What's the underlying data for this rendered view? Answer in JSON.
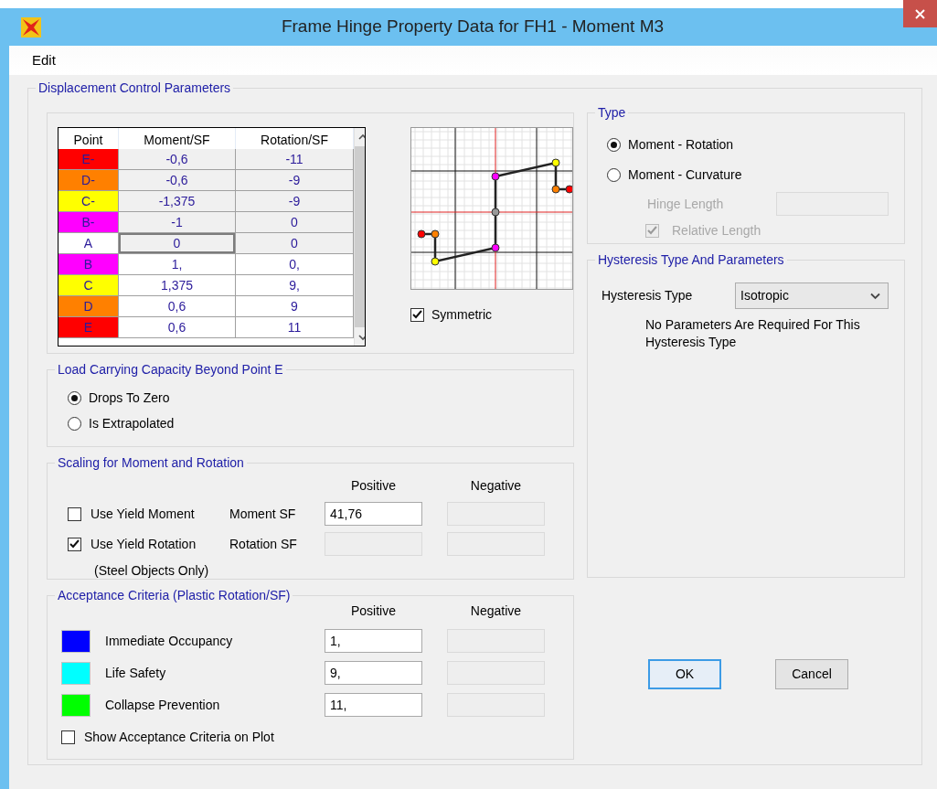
{
  "window": {
    "title": "Frame Hinge Property Data for FH1 - Moment M3"
  },
  "menu": [
    {
      "label": "Edit"
    }
  ],
  "displacement": {
    "title": "Displacement Control Parameters",
    "table": {
      "columns": [
        "Point",
        "Moment/SF",
        "Rotation/SF"
      ],
      "rows": [
        {
          "point": "E-",
          "color": "#ff0000",
          "moment": "-0,6",
          "rotation": "-11",
          "disabled": true,
          "selected": false
        },
        {
          "point": "D-",
          "color": "#ff8000",
          "moment": "-0,6",
          "rotation": "-9",
          "disabled": true,
          "selected": false
        },
        {
          "point": "C-",
          "color": "#ffff00",
          "moment": "-1,375",
          "rotation": "-9",
          "disabled": true,
          "selected": false
        },
        {
          "point": "B-",
          "color": "#ff00ff",
          "moment": "-1",
          "rotation": "0",
          "disabled": true,
          "selected": false
        },
        {
          "point": "A",
          "color": "#ffffff",
          "moment": "0",
          "rotation": "0",
          "disabled": true,
          "selected": true
        },
        {
          "point": "B",
          "color": "#ff00ff",
          "moment": "1,",
          "rotation": "0,",
          "disabled": false,
          "selected": false
        },
        {
          "point": "C",
          "color": "#ffff00",
          "moment": "1,375",
          "rotation": "9,",
          "disabled": false,
          "selected": false
        },
        {
          "point": "D",
          "color": "#ff8000",
          "moment": "0,6",
          "rotation": "9",
          "disabled": false,
          "selected": false
        },
        {
          "point": "E",
          "color": "#ff0000",
          "moment": "0,6",
          "rotation": "11",
          "disabled": false,
          "selected": false
        }
      ]
    },
    "symmetric": {
      "label": "Symmetric",
      "checked": true
    }
  },
  "type": {
    "title": "Type",
    "options": [
      {
        "label": "Moment - Rotation",
        "selected": true
      },
      {
        "label": "Moment - Curvature",
        "selected": false
      }
    ],
    "hinge_length": {
      "label": "Hinge Length",
      "disabled": true
    },
    "relative_length": {
      "label": "Relative Length",
      "checked": true,
      "disabled": true
    }
  },
  "hysteresis": {
    "title": "Hysteresis Type And Parameters",
    "label": "Hysteresis Type",
    "value": "Isotropic",
    "note": "No Parameters Are Required For This Hysteresis Type"
  },
  "load_capacity": {
    "title": "Load Carrying Capacity Beyond Point E",
    "options": [
      {
        "label": "Drops To Zero",
        "selected": true
      },
      {
        "label": "Is Extrapolated",
        "selected": false
      }
    ]
  },
  "scaling": {
    "title": "Scaling for Moment and Rotation",
    "headings": [
      "Positive",
      "Negative"
    ],
    "rows": [
      {
        "check_label": "Use Yield Moment",
        "checked": false,
        "sf_label": "Moment SF",
        "positive": {
          "value": "41,76",
          "disabled": false
        },
        "negative": {
          "disabled": true
        }
      },
      {
        "check_label": "Use Yield Rotation",
        "checked": true,
        "sf_label": "Rotation SF",
        "positive": {
          "disabled": true
        },
        "negative": {
          "disabled": true
        }
      }
    ],
    "note": "(Steel Objects Only)"
  },
  "acceptance": {
    "title": "Acceptance Criteria (Plastic Rotation/SF)",
    "headings": [
      "Positive",
      "Negative"
    ],
    "rows": [
      {
        "label": "Immediate Occupancy",
        "color": "#0000ff",
        "positive": {
          "value": "1,",
          "disabled": false
        },
        "negative": {
          "disabled": true
        }
      },
      {
        "label": "Life Safety",
        "color": "#00ffff",
        "positive": {
          "value": "9,",
          "disabled": false
        },
        "negative": {
          "disabled": true
        }
      },
      {
        "label": "Collapse Prevention",
        "color": "#00ff00",
        "positive": {
          "value": "11,",
          "disabled": false
        },
        "negative": {
          "disabled": true
        }
      }
    ],
    "show_on_plot": {
      "label": "Show Acceptance Criteria on Plot",
      "checked": false
    }
  },
  "buttons": [
    {
      "label": "OK",
      "default": true
    },
    {
      "label": "Cancel",
      "default": false
    }
  ]
}
